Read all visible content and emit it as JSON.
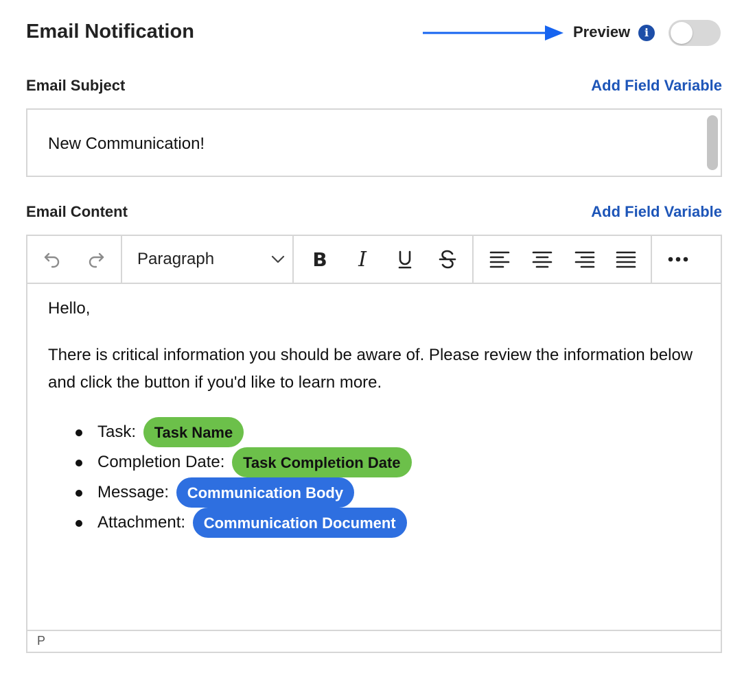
{
  "header": {
    "title": "Email Notification",
    "preview_label": "Preview",
    "preview_on": false
  },
  "subject": {
    "label": "Email Subject",
    "add_variable": "Add Field Variable",
    "value": "New Communication!"
  },
  "content": {
    "label": "Email Content",
    "add_variable": "Add Field Variable",
    "toolbar": {
      "block_format": "Paragraph",
      "icons": [
        "undo-icon",
        "redo-icon",
        "bold-icon",
        "italic-icon",
        "underline-icon",
        "strikethrough-icon",
        "align-left-icon",
        "align-center-icon",
        "align-right-icon",
        "justify-icon",
        "more-icon"
      ]
    },
    "greeting": "Hello,",
    "body": "There is critical information you should be aware of. Please review the information below and click the button if you'd like to learn more.",
    "items": [
      {
        "label": "Task:",
        "pill": "Task Name",
        "color": "#6cc04a"
      },
      {
        "label": "Completion Date:",
        "pill": "Task Completion Date",
        "color": "#6cc04a"
      },
      {
        "label": "Message:",
        "pill": "Communication Body",
        "color": "#2e6fe0"
      },
      {
        "label": "Attachment:",
        "pill": "Communication Document",
        "color": "#2e6fe0"
      }
    ],
    "status_path": "P"
  }
}
